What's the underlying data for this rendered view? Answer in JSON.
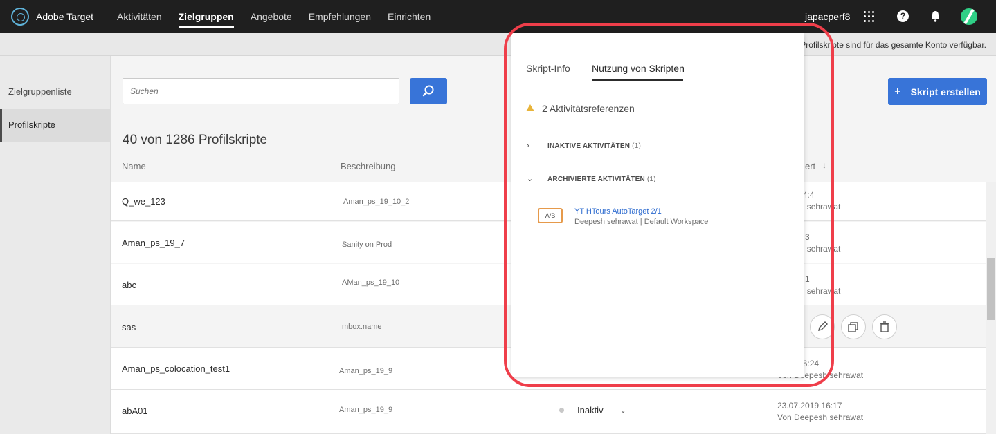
{
  "topnav": {
    "app_name": "Adobe Target",
    "items": [
      "Aktivitäten",
      "Zielgruppen",
      "Angebote",
      "Empfehlungen",
      "Einrichten"
    ],
    "user": "japacperf8",
    "help_glyph": "?"
  },
  "infobar": {
    "text": "Profilskripte sind für das gesamte Konto verfügbar."
  },
  "sidebar": {
    "items": [
      "Zielgruppenliste",
      "Profilskripte"
    ]
  },
  "main": {
    "search_placeholder": "Suchen",
    "create_label": "Skript erstellen",
    "create_plus": "+",
    "count": "40 von 1286 Profilskripte",
    "columns": {
      "name": "Name",
      "description": "Beschreibung",
      "modified": "ert"
    },
    "rows": [
      {
        "name": "Q_we_123",
        "desc": "Aman_ps_19_10_2",
        "date": "2019 14:4",
        "by": "eepesh sehrawat"
      },
      {
        "name": "Aman_ps_19_7",
        "desc": "Sanity on Prod",
        "date": "019 14:3",
        "by": "eepesh sehrawat"
      },
      {
        "name": "abc",
        "desc": "AMan_ps_19_10",
        "date": "019 14:1",
        "by": "eepesh sehrawat"
      },
      {
        "name": "sas",
        "desc": "mbox.name"
      },
      {
        "name": "Aman_ps_colocation_test1",
        "desc": "Aman_ps_19_9",
        "date": "2019 16:24",
        "by": "Von Deepesh sehrawat"
      },
      {
        "name": "abA01",
        "desc": "Aman_ps_19_9",
        "date": "23.07.2019 16:17",
        "by": "Von Deepesh sehrawat",
        "status": "Inaktiv"
      }
    ]
  },
  "popover": {
    "tabs": [
      "Skript-Info",
      "Nutzung von Skripten"
    ],
    "references": "2 Aktivitätsreferenzen",
    "section_inactive": {
      "label": "INAKTIVE AKTIVITÄTEN",
      "count": "(1)"
    },
    "section_archived": {
      "label": "ARCHIVIERTE AKTIVITÄTEN",
      "count": "(1)"
    },
    "activity": {
      "badge": "A/B",
      "title": "YT HTours AutoTarget 2/1",
      "sub": "Deepesh sehrawat | Default Workspace"
    }
  },
  "colors": {
    "accent": "#3874d8",
    "highlight": "#ef3e4a",
    "warning": "#e8b43a",
    "badge": "#e69a4b"
  }
}
